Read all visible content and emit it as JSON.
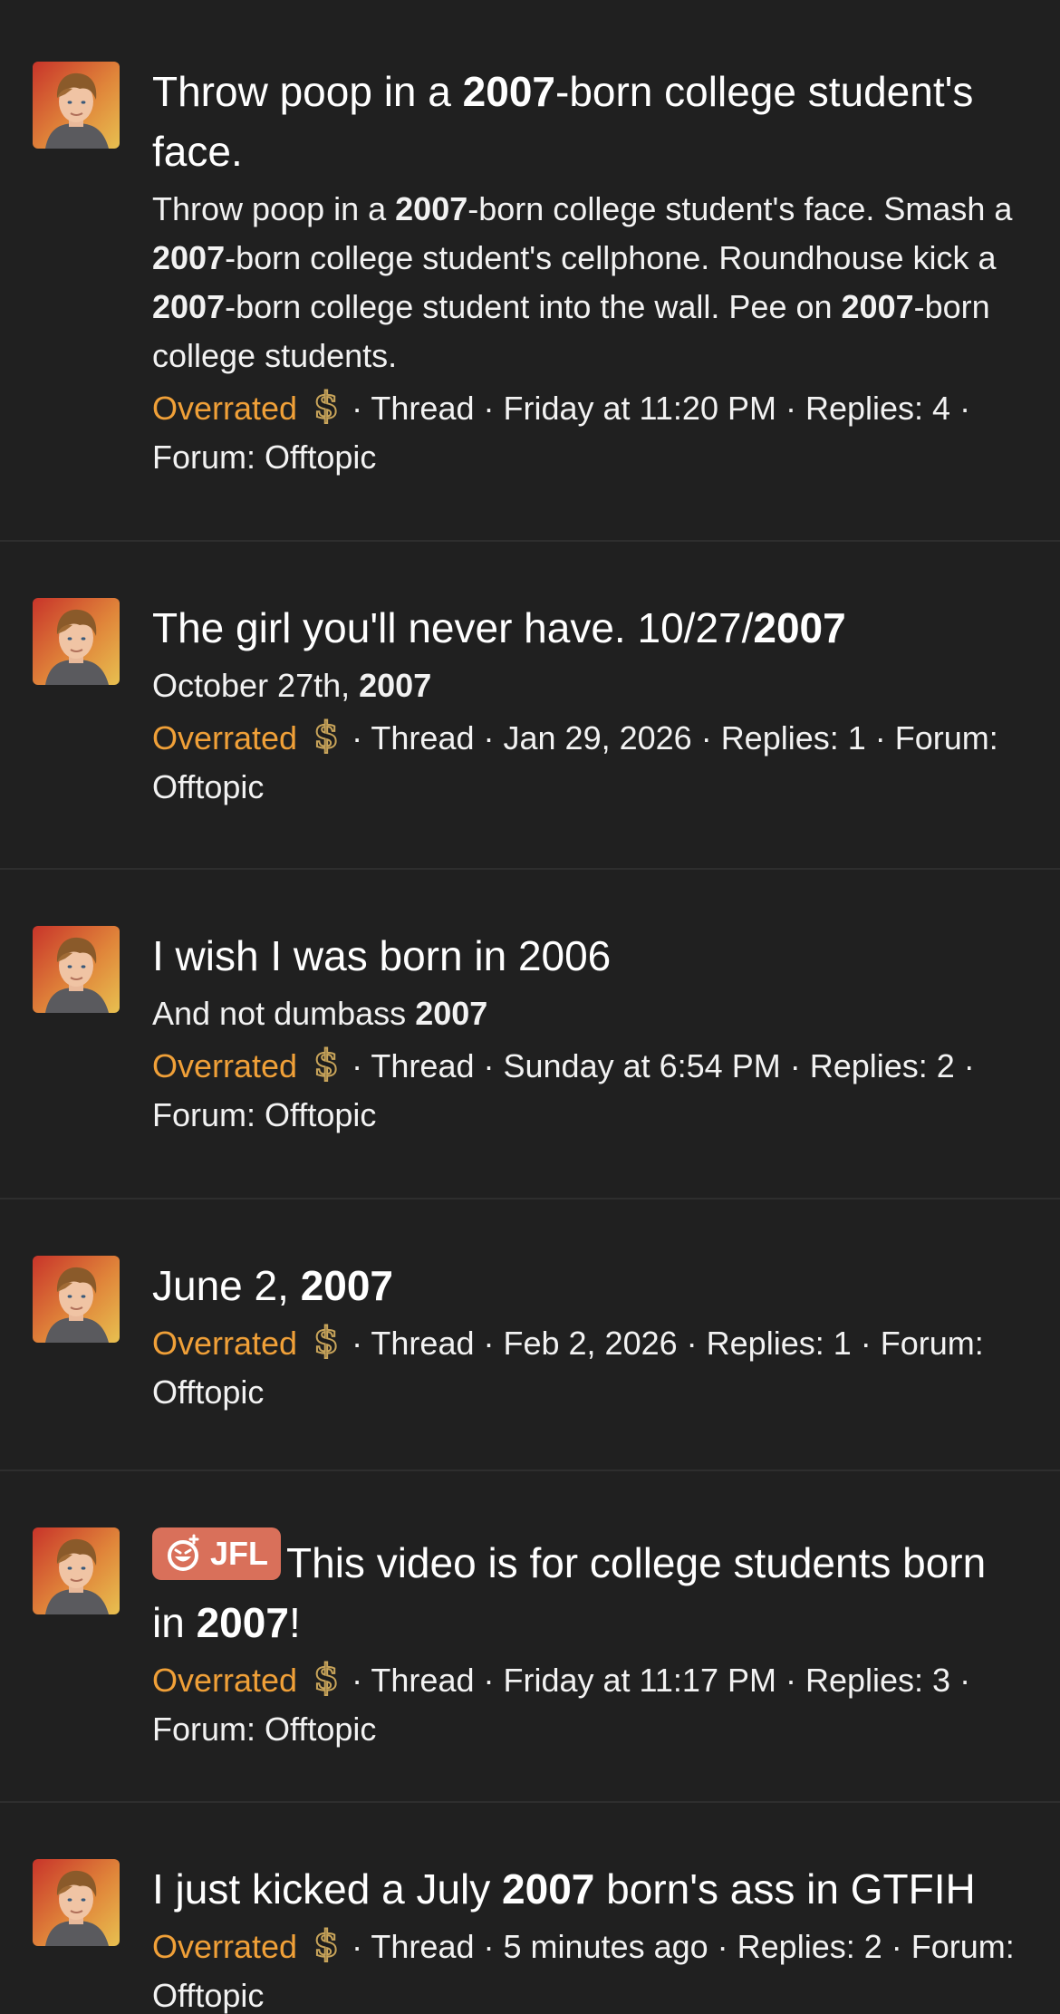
{
  "results": [
    {
      "title": [
        {
          "t": "Throw poop in a "
        },
        {
          "t": "2007",
          "b": true
        },
        {
          "t": "-born college student's face."
        }
      ],
      "snippet": [
        {
          "t": "Throw poop in a "
        },
        {
          "t": "2007",
          "b": true
        },
        {
          "t": "-born college student's face. Smash a "
        },
        {
          "t": "2007",
          "b": true
        },
        {
          "t": "-born college student's cellphone. Roundhouse kick a "
        },
        {
          "t": "2007",
          "b": true
        },
        {
          "t": "-born college student into the wall. Pee on "
        },
        {
          "t": "2007",
          "b": true
        },
        {
          "t": "-born college students."
        }
      ],
      "author": "Overrated",
      "type": "Thread",
      "date": "Friday at 11:20 PM",
      "replies": "Replies: 4",
      "forum": "Forum: Offtopic",
      "top": 0,
      "height": 598
    },
    {
      "title": [
        {
          "t": "The girl you'll never have. 10/27/"
        },
        {
          "t": "2007",
          "b": true
        }
      ],
      "snippet": [
        {
          "t": "October 27th, "
        },
        {
          "t": "2007",
          "b": true
        }
      ],
      "author": "Overrated",
      "type": "Thread",
      "date": "Jan 29, 2026",
      "replies": "Replies: 1",
      "forum": "Forum: Offtopic"
    },
    {
      "title": [
        {
          "t": "I wish I was born in 2006"
        }
      ],
      "snippet": [
        {
          "t": "And not dumbass "
        },
        {
          "t": "2007",
          "b": true
        }
      ],
      "author": "Overrated",
      "type": "Thread",
      "date": "Sunday at 6:54 PM",
      "replies": "Replies: 2",
      "forum": "Forum: Offtopic"
    },
    {
      "title": [
        {
          "t": "June 2, "
        },
        {
          "t": "2007",
          "b": true
        }
      ],
      "snippet": [],
      "author": "Overrated",
      "type": "Thread",
      "date": "Feb 2, 2026",
      "replies": "Replies: 1",
      "forum": "Forum: Offtopic"
    },
    {
      "prefix": "JFL",
      "title": [
        {
          "t": "This video is for college students born in "
        },
        {
          "t": "2007",
          "b": true
        },
        {
          "t": "!"
        }
      ],
      "snippet": [],
      "author": "Overrated",
      "type": "Thread",
      "date": "Friday at 11:17 PM",
      "replies": "Replies: 3",
      "forum": "Forum: Offtopic"
    },
    {
      "title": [
        {
          "t": "I just kicked a July "
        },
        {
          "t": "2007",
          "b": true
        },
        {
          "t": " born's ass in GTFIH"
        }
      ],
      "snippet": [],
      "author": "Overrated",
      "type": "Thread",
      "date": "5 minutes ago",
      "replies": "Replies: 2",
      "forum": "Forum: Offtopic"
    }
  ],
  "icons": {
    "user_badge": "dollar-sign-icon",
    "prefix_icon": "laughing-face-icon"
  },
  "colors": {
    "background": "#202020",
    "divider": "#2e2e2e",
    "username": "#f0a038",
    "prefix_badge": "#d9705a"
  }
}
